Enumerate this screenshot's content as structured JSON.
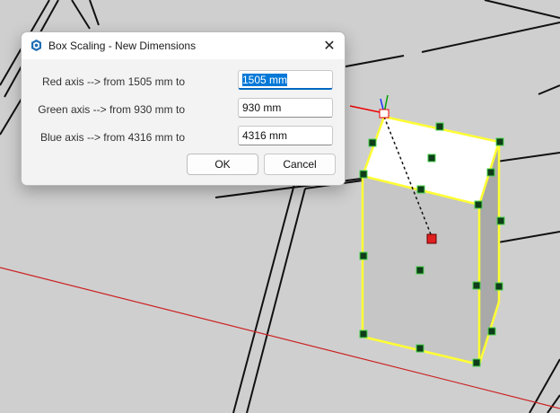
{
  "dialog": {
    "title": "Box Scaling - New Dimensions",
    "icon": "sketchup-icon",
    "rows": [
      {
        "label": "Red axis --> from 1505 mm to",
        "value": "1505 mm"
      },
      {
        "label": "Green axis --> from 930 mm to",
        "value": "930 mm"
      },
      {
        "label": "Blue axis --> from 4316 mm to",
        "value": "4316 mm"
      }
    ],
    "ok_label": "OK",
    "cancel_label": "Cancel",
    "close_glyph": "✕"
  },
  "viewport": {
    "background": "#cfcfcf",
    "selection_color": "#ffff33",
    "grip_color": "#0f3d1a",
    "red_axis_color": "#cc0000"
  }
}
